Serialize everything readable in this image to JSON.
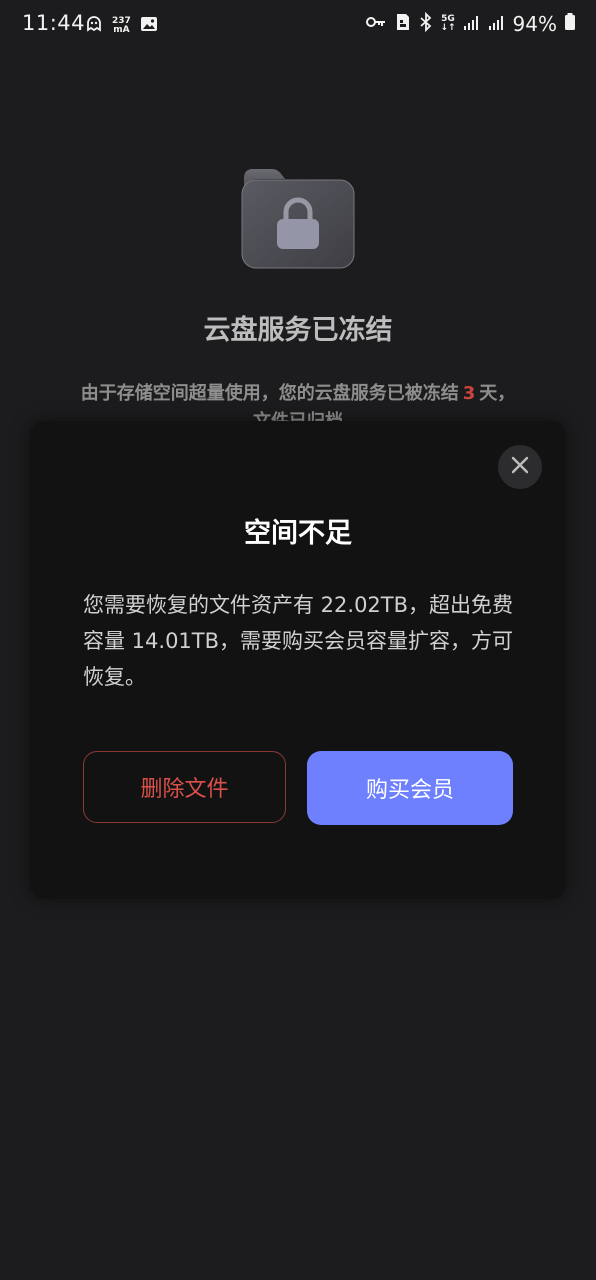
{
  "status_bar": {
    "time": "11:44",
    "current_top": "237",
    "current_bottom": "mA",
    "network_top": "5G",
    "network_bottom": "↓↑",
    "battery": "94%"
  },
  "frozen": {
    "icon": "locked-folder-icon",
    "title": "云盘服务已冻结",
    "desc_prefix": "由于存储空间超量使用，您的云盘服务已被冻结",
    "days": "3",
    "desc_suffix": "天，",
    "desc_line2": "文件已归档"
  },
  "dialog": {
    "close_icon": "close-icon",
    "title": "空间不足",
    "body": "您需要恢复的文件资产有 22.02TB，超出免费容量 14.01TB，需要购买会员容量扩容，方可恢复。",
    "delete_label": "删除文件",
    "buy_label": "购买会员"
  },
  "colors": {
    "background": "#1c1c1e",
    "dialog_bg": "#121212",
    "accent": "#6f80ff",
    "danger": "#d9514a"
  }
}
